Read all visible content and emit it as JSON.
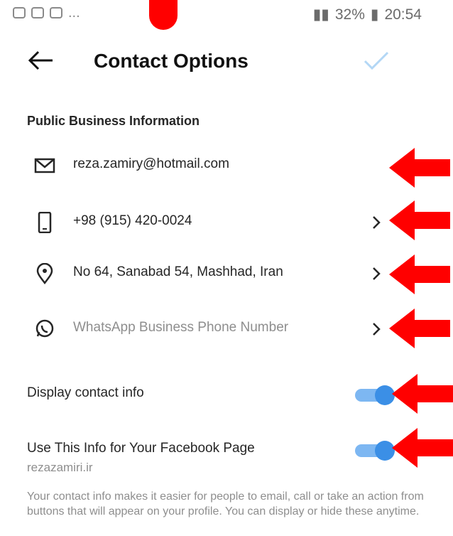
{
  "status_bar": {
    "left_icons": [
      "whatsapp-icon",
      "image-icon",
      "instagram-icon"
    ],
    "left_more": "...",
    "right_text": "32%",
    "time": "20:54"
  },
  "header": {
    "title": "Contact Options"
  },
  "section": {
    "title": "Public Business Information"
  },
  "contacts": [
    {
      "icon": "mail-icon",
      "text": "reza.zamiry@hotmail.com",
      "chevron": false
    },
    {
      "icon": "phone-icon",
      "text": "+98 (915) 420-0024",
      "chevron": true
    },
    {
      "icon": "location-icon",
      "text": "No 64, Sanabad 54, Mashhad, Iran",
      "chevron": true
    },
    {
      "icon": "whatsapp-icon",
      "text": "WhatsApp Business Phone Number",
      "chevron": true
    }
  ],
  "toggles": {
    "display_contact": {
      "label": "Display contact info",
      "state": "on"
    },
    "facebook_page": {
      "label": "Use This Info for Your Facebook Page",
      "subtext": "rezazamiri.ir",
      "state": "on"
    }
  },
  "footer_text": "Your contact info makes it easier for people to email, call or take an action from buttons that will appear on your profile. You can display or hide these anytime.",
  "colors": {
    "accent_toggle": "#3b8fe6",
    "arrow_red": "#ff0000",
    "check_inactive": "#b3d7f5"
  }
}
